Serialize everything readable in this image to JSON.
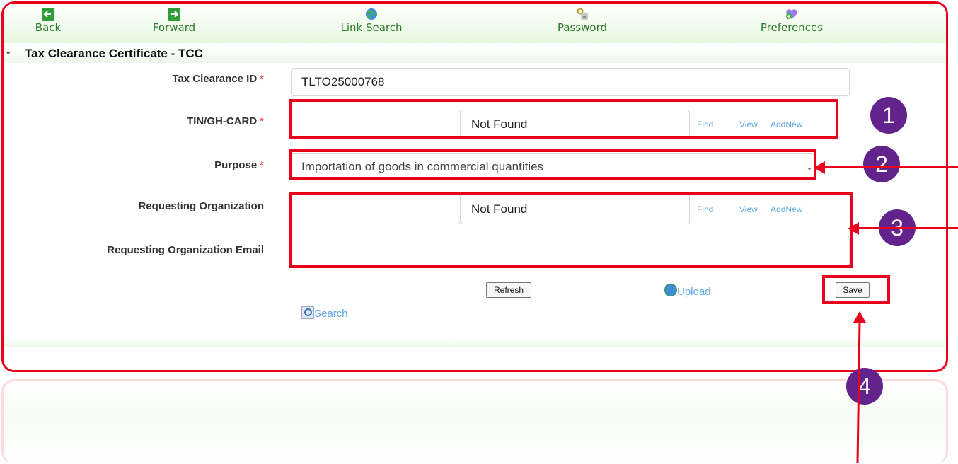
{
  "toolbar": {
    "back": "Back",
    "forward": "Forward",
    "link_search": "Link Search",
    "password": "Password",
    "preferences": "Preferences"
  },
  "page_title": "Tax Clearance Certificate - TCC",
  "form": {
    "tax_clearance_id": {
      "label": "Tax Clearance ID",
      "required": "*",
      "value": "TLTO25000768"
    },
    "tin": {
      "label": "TIN/GH-CARD",
      "required": "*",
      "value": "",
      "lookup": "Not Found"
    },
    "purpose": {
      "label": "Purpose",
      "required": "*",
      "value": "Importation of goods in commercial quantities"
    },
    "requesting_org": {
      "label": "Requesting Organization",
      "value": "",
      "lookup": "Not Found"
    },
    "requesting_org_email": {
      "label": "Requesting Organization Email",
      "value": ""
    }
  },
  "links": {
    "find": "Find",
    "view": "View",
    "addnew": "AddNew"
  },
  "actions": {
    "refresh": "Refresh",
    "upload": "Upload",
    "save": "Save",
    "search": "Search"
  },
  "callouts": [
    "1",
    "2",
    "3",
    "4"
  ],
  "colors": {
    "highlight": "#e8001c",
    "badge": "#62248c",
    "toolbar_text": "#2a7a2a",
    "link": "#5fa8e6"
  }
}
